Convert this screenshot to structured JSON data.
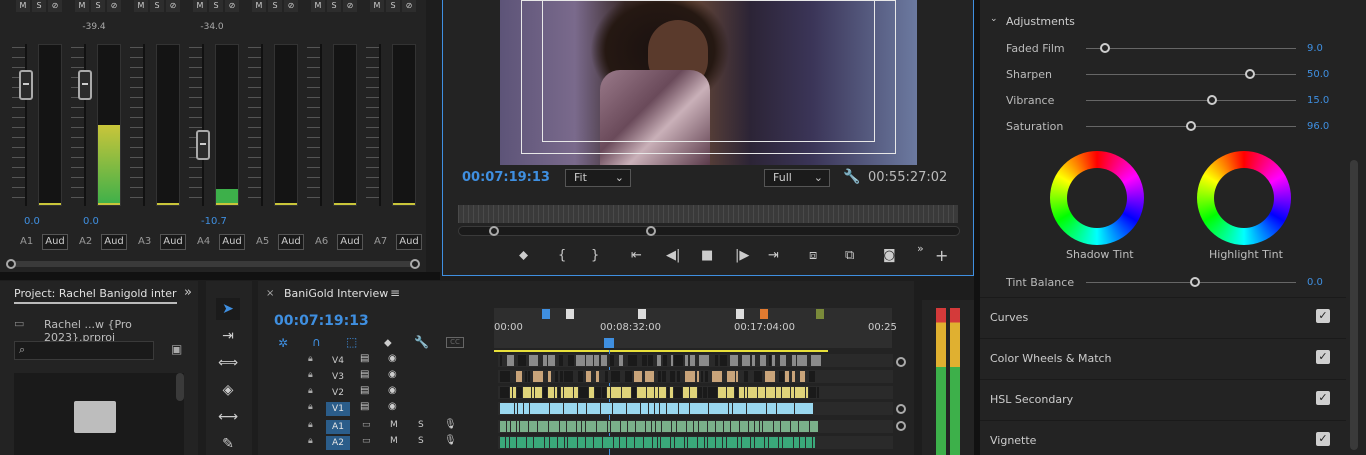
{
  "mixer": {
    "ms_labels": [
      "M",
      "S",
      "⊘"
    ],
    "channels": [
      {
        "name": "A1",
        "peak": "",
        "volume": "0.0",
        "aud": "Aud"
      },
      {
        "name": "A2",
        "peak": "-39.4",
        "volume": "0.0",
        "aud": "Aud"
      },
      {
        "name": "A3",
        "peak": "",
        "volume": "",
        "aud": "Aud"
      },
      {
        "name": "A4",
        "peak": "-34.0",
        "volume": "-10.7",
        "aud": "Aud"
      },
      {
        "name": "A5",
        "peak": "",
        "volume": "",
        "aud": "Aud"
      },
      {
        "name": "A6",
        "peak": "",
        "volume": "",
        "aud": "Aud"
      },
      {
        "name": "A7",
        "peak": "",
        "volume": "",
        "aud": "Aud"
      }
    ]
  },
  "program": {
    "current_time": "00:07:19:13",
    "fit": "Fit",
    "quality": "Full",
    "duration": "00:55:27:02"
  },
  "lumetri": {
    "adjustments_label": "Adjustments",
    "sliders": [
      {
        "label": "Faded Film",
        "value": "9.0",
        "fraction": 0.09
      },
      {
        "label": "Sharpen",
        "value": "50.0",
        "fraction": 0.78
      },
      {
        "label": "Vibrance",
        "value": "15.0",
        "fraction": 0.6
      },
      {
        "label": "Saturation",
        "value": "96.0",
        "fraction": 0.5
      }
    ],
    "shadow_tint": "Shadow Tint",
    "highlight_tint": "Highlight Tint",
    "tint_balance": {
      "label": "Tint Balance",
      "value": "0.0",
      "fraction": 0.52
    },
    "sections": [
      "Curves",
      "Color Wheels & Match",
      "HSL Secondary",
      "Vignette"
    ],
    "check_glyph": "✓"
  },
  "project": {
    "title": "Project: Rachel Banigold inter",
    "file": "Rachel ...w {Pro 2023}.prproj"
  },
  "timeline": {
    "sequence_name": "BaniGold Interview",
    "timecode": "00:07:19:13",
    "ruler": [
      "00:00",
      "00:08:32:00",
      "00:17:04:00",
      "00:25"
    ],
    "tracks": [
      {
        "name": "V4",
        "active": false
      },
      {
        "name": "V3",
        "active": false
      },
      {
        "name": "V2",
        "active": false
      },
      {
        "name": "V1",
        "active": true
      },
      {
        "name": "A1",
        "active": true
      },
      {
        "name": "A2",
        "active": true
      }
    ],
    "audio_m": "M",
    "audio_s": "S"
  },
  "colors": {
    "accent": "#3f8fe0"
  }
}
